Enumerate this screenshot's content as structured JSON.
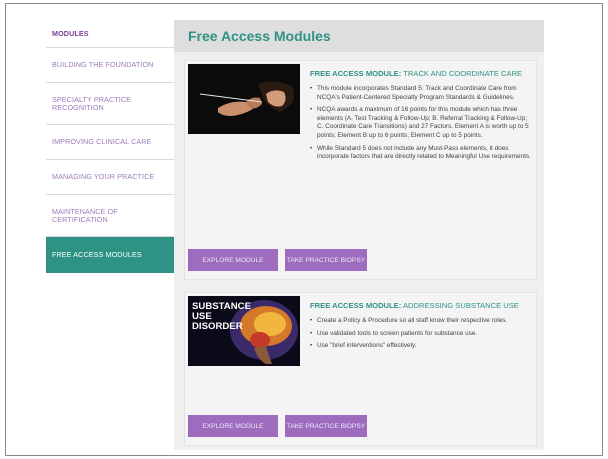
{
  "sidebar": {
    "items": [
      {
        "label": "MODULES"
      },
      {
        "label": "BUILDING THE FOUNDATION"
      },
      {
        "label": "SPECIALTY PRACTICE RECOGNITION"
      },
      {
        "label": "IMPROVING CLINICAL CARE"
      },
      {
        "label": "MANAGING YOUR PRACTICE"
      },
      {
        "label": "MAINTENANCE OF CERTIFICATION"
      },
      {
        "label": "FREE ACCESS MODULES"
      }
    ]
  },
  "main": {
    "title": "Free Access Modules",
    "cards": [
      {
        "heading_prefix": "FREE ACCESS MODULE:",
        "heading_rest": " TRACK AND COORDINATE CARE",
        "bullets": [
          "This module incorporates Standard 5: Track and Coordinate Care from NCQA's Patient-Centered Specialty Program Standards & Guidelines.",
          "NCQA awards a maximum of 16 points for this module which has three elements (A. Test Tracking & Follow-Up; B. Referral Tracking & Follow-Up; C. Coordinate Care Transitions) and 27 Factors. Element A is worth up to 5 points; Element B up to 6 points; Element C up to 5 points.",
          "While Standard 5 does not include any Must-Pass elements, it does incorporate factors that are directly related to Meaningful Use requirements."
        ],
        "explore_label": "EXPLORE MODULE",
        "biopsy_label": "TAKE PRACTICE BIOPSY"
      },
      {
        "heading_prefix": "FREE ACCESS MODULE:",
        "heading_rest": " ADDRESSING SUBSTANCE USE",
        "image_text": [
          "SUBSTANCE",
          "USE",
          "DISORDER"
        ],
        "bullets": [
          "Create a Policy & Procedure so all staff know their respective roles.",
          "Use validated tools to screen patients for substance use.",
          "Use \"brief interventions\" effectively."
        ],
        "explore_label": "EXPLORE MODULE",
        "biopsy_label": "TAKE PRACTICE BIOPSY"
      }
    ]
  },
  "colors": {
    "accent": "#2e9284",
    "button": "#9d6cbe",
    "sidebar_text": "#9b7cb6"
  }
}
